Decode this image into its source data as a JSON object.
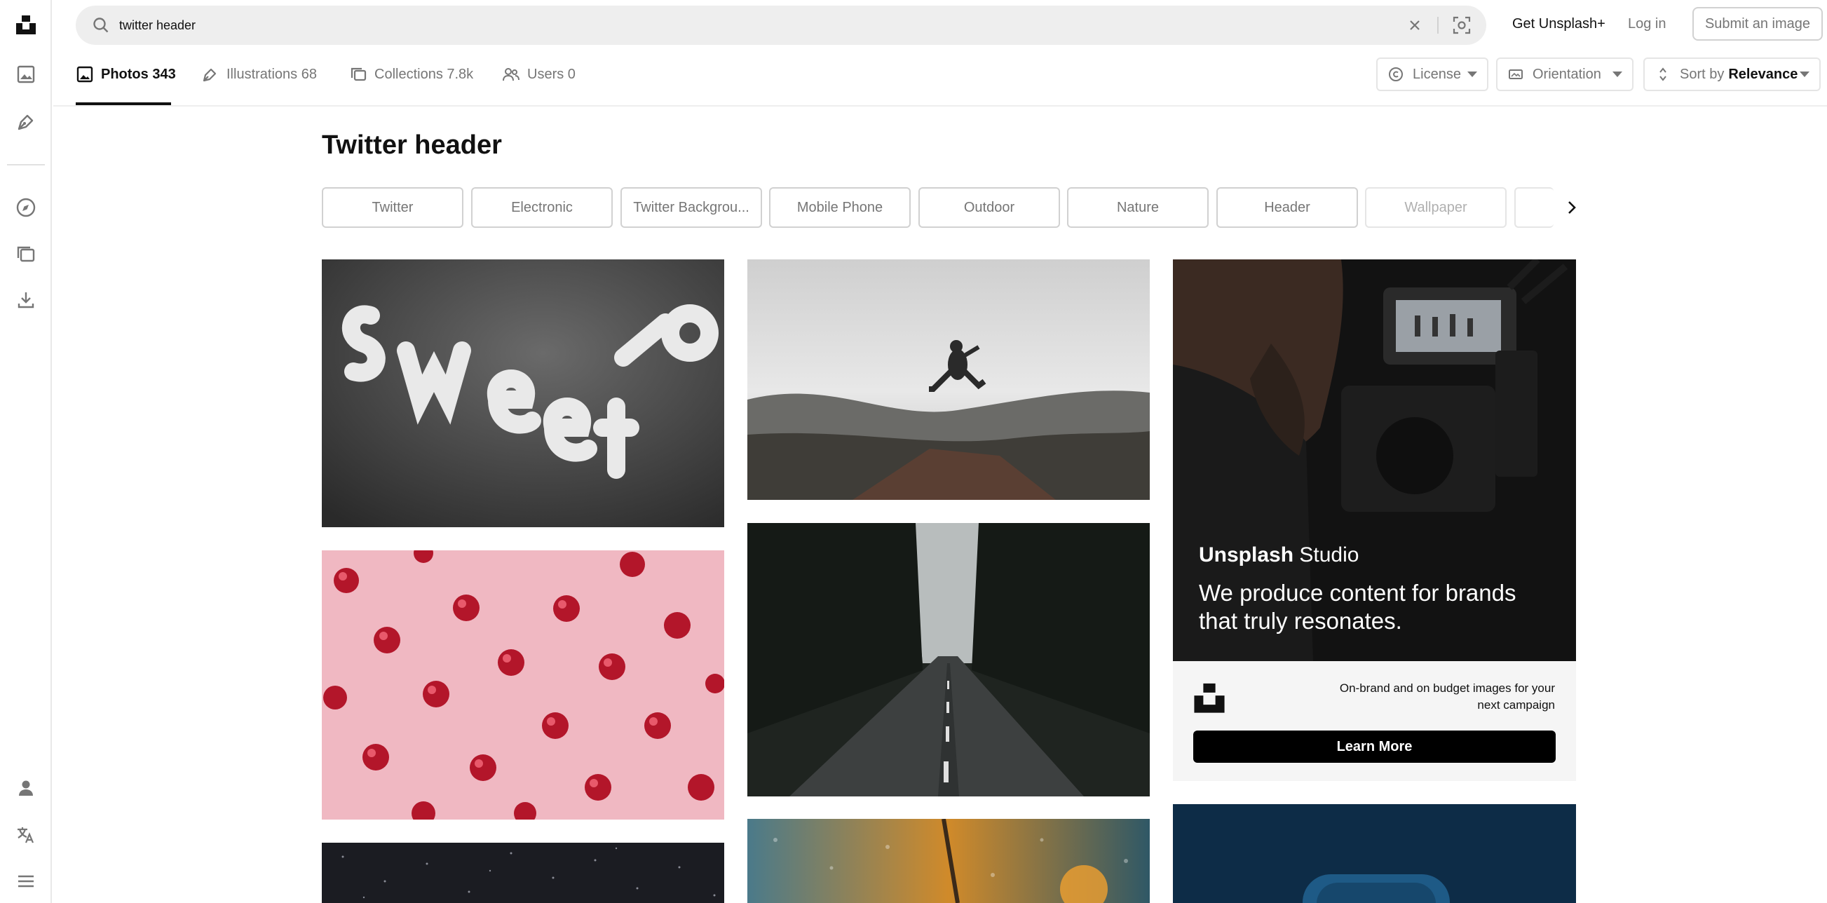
{
  "search": {
    "query": "twitter header"
  },
  "header": {
    "get_plus": "Get Unsplash+",
    "log_in": "Log in",
    "submit": "Submit an image"
  },
  "tabs": [
    {
      "label": "Photos 343",
      "icon": "photo-icon"
    },
    {
      "label": "Illustrations 68",
      "icon": "pen-icon"
    },
    {
      "label": "Collections 7.8k",
      "icon": "collections-icon"
    },
    {
      "label": "Users 0",
      "icon": "users-icon"
    }
  ],
  "filters": {
    "license": "License",
    "orientation": "Orientation",
    "sort_prefix": "Sort by",
    "sort_value": "Relevance"
  },
  "page_title": "Twitter header",
  "related": [
    "Twitter",
    "Electronic",
    "Twitter Backgrou...",
    "Mobile Phone",
    "Outdoor",
    "Nature",
    "Header",
    "Wallpaper"
  ],
  "ad": {
    "brand_bold": "Unsplash",
    "brand_rest": " Studio",
    "headline": "We produce content for brands that truly resonates.",
    "tagline": "On-brand and on budget images for your next campaign",
    "cta": "Learn More"
  },
  "photos": [
    {
      "subject": "Sweet 16 balloon letters"
    },
    {
      "subject": "man jumping over mountains"
    },
    {
      "subject": "red ornaments on pink background"
    },
    {
      "subject": "road through dark forest"
    },
    {
      "subject": "dark starry texture"
    },
    {
      "subject": "rainy window with lights"
    },
    {
      "subject": "blue device illustration"
    }
  ],
  "colors": {
    "accent": "#111111",
    "muted": "#767676",
    "border": "#d1d1d1",
    "search_bg": "#eeeeee"
  }
}
